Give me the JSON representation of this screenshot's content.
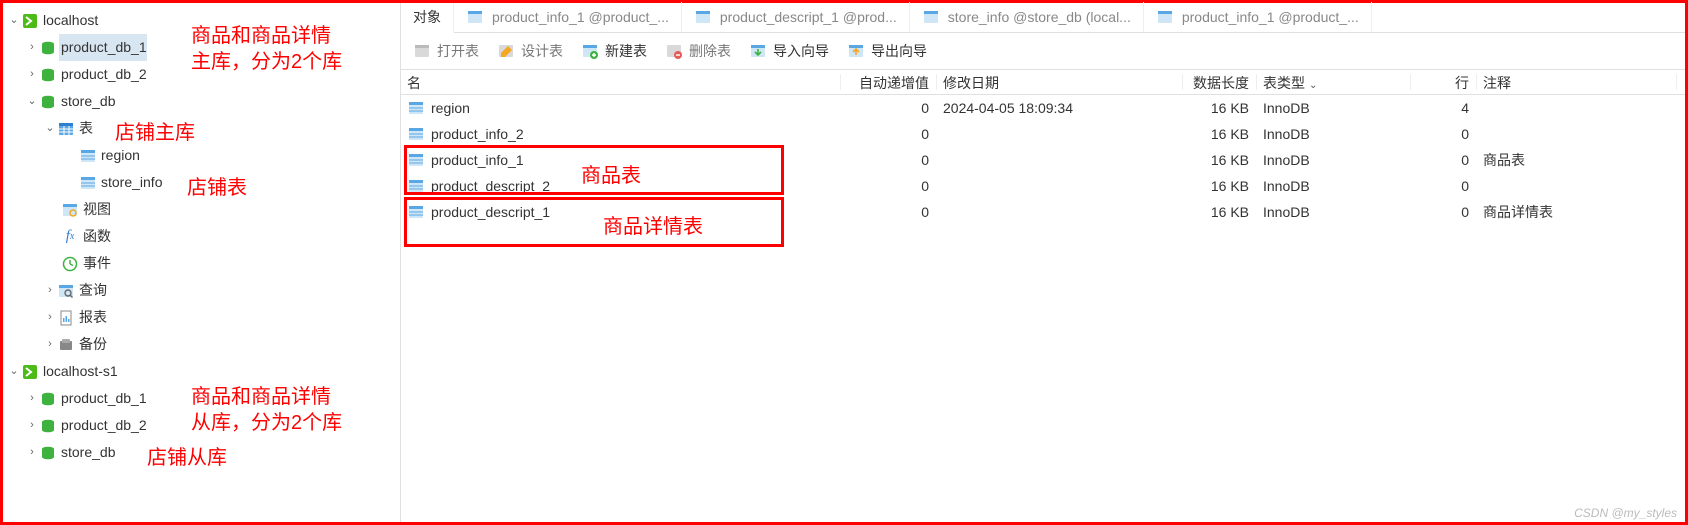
{
  "sidebar": {
    "conn1": {
      "name": "localhost",
      "db1": "product_db_1",
      "db2": "product_db_2",
      "db3": "store_db",
      "db3_tables_folder": "表",
      "db3_tbl1": "region",
      "db3_tbl2": "store_info",
      "db3_views": "视图",
      "db3_funcs": "函数",
      "db3_events": "事件",
      "db3_queries": "查询",
      "db3_reports": "报表",
      "db3_backup": "备份"
    },
    "conn2": {
      "name": "localhost-s1",
      "db1": "product_db_1",
      "db2": "product_db_2",
      "db3": "store_db"
    }
  },
  "annotations": {
    "a1_line1": "商品和商品详情",
    "a1_line2": "主库，分为2个库",
    "a2": "店铺主库",
    "a3": "店铺表",
    "a4_line1": "商品和商品详情",
    "a4_line2": "从库，分为2个库",
    "a5": "店铺从库",
    "a6": "商品表",
    "a7": "商品详情表"
  },
  "tabs": {
    "t0": "对象",
    "t1": "product_info_1 @product_...",
    "t2": "product_descript_1 @prod...",
    "t3": "store_info @store_db (local...",
    "t4": "product_info_1 @product_..."
  },
  "toolbar": {
    "open": "打开表",
    "design": "设计表",
    "new": "新建表",
    "delete": "删除表",
    "import": "导入向导",
    "export": "导出向导"
  },
  "columns": {
    "name": "名",
    "auto": "自动递增值",
    "date": "修改日期",
    "size": "数据长度",
    "type": "表类型",
    "rows": "行",
    "comment": "注释"
  },
  "rows": [
    {
      "name": "region",
      "auto": "0",
      "date": "2024-04-05 18:09:34",
      "size": "16 KB",
      "type": "InnoDB",
      "rows": "4",
      "comment": ""
    },
    {
      "name": "product_info_2",
      "auto": "0",
      "date": "",
      "size": "16 KB",
      "type": "InnoDB",
      "rows": "0",
      "comment": ""
    },
    {
      "name": "product_info_1",
      "auto": "0",
      "date": "",
      "size": "16 KB",
      "type": "InnoDB",
      "rows": "0",
      "comment": "商品表"
    },
    {
      "name": "product_descript_2",
      "auto": "0",
      "date": "",
      "size": "16 KB",
      "type": "InnoDB",
      "rows": "0",
      "comment": ""
    },
    {
      "name": "product_descript_1",
      "auto": "0",
      "date": "",
      "size": "16 KB",
      "type": "InnoDB",
      "rows": "0",
      "comment": "商品详情表"
    }
  ],
  "watermark": "CSDN @my_styles"
}
